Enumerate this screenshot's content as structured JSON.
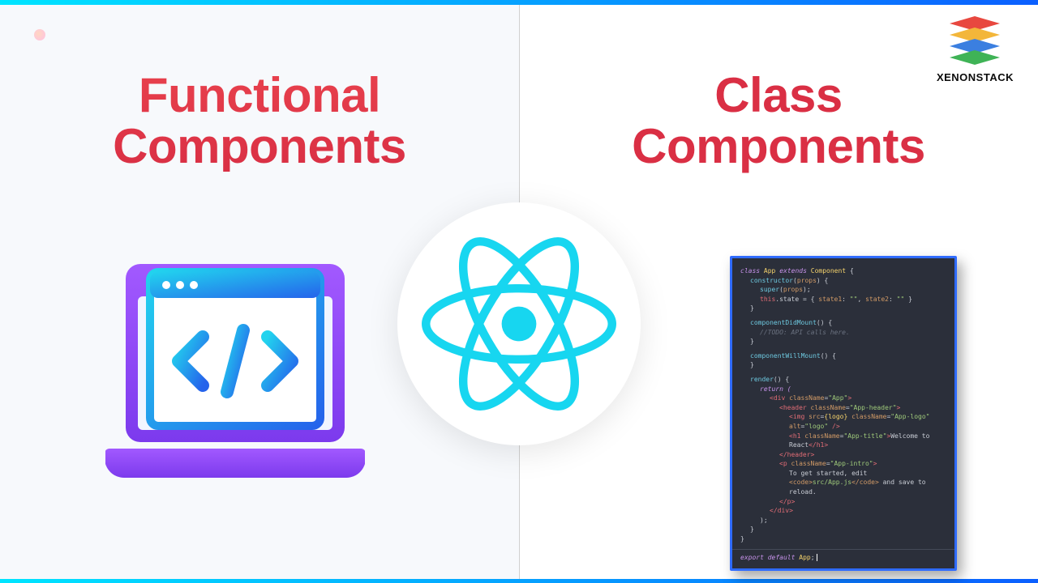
{
  "brand": {
    "name": "XENONSTACK"
  },
  "left": {
    "title_line1": "Functional",
    "title_line2": "Components"
  },
  "right": {
    "title_line1": "Class",
    "title_line2": "Components"
  },
  "colors": {
    "accent_red": "#da2f44",
    "react_cyan": "#17d6f0",
    "frame_blue": "#2f6bff"
  },
  "code": {
    "l1_kw1": "class",
    "l1_cls": "App",
    "l1_kw2": "extends",
    "l1_sup": "Component",
    "l1_brace": "{",
    "l2_fn": "constructor",
    "l2_arg": "props",
    "l2_brace": "{",
    "l3_super": "super",
    "l3_arg": "props",
    "l3_end": ";",
    "l4_this": "this",
    "l4_state": ".state = { ",
    "l4_k1": "state1",
    "l4_v1": "\"\"",
    "l4_k2": "state2",
    "l4_v2": "\"\"",
    "l4_end": " }",
    "l5_close": "}",
    "l6_fn": "componentDidMount",
    "l6_rest": "() {",
    "l7_comment": "//TODO: API calls here.",
    "l8_close": "}",
    "l9_fn": "componentWillMount",
    "l9_rest": "() {",
    "l10_close": "}",
    "l11_fn": "render",
    "l11_rest": "() {",
    "l12_ret": "return (",
    "l13_open": "<div ",
    "l13_attr": "className",
    "l13_val": "\"App\"",
    "l13_end": ">",
    "l14_open": "<header ",
    "l14_attr": "className",
    "l14_val": "\"App-header\"",
    "l14_end": ">",
    "l15_open": "<img ",
    "l15_a1": "src",
    "l15_v1": "{logo}",
    "l15_a2": "className",
    "l15_v2": "\"App-logo\"",
    "l15_a3": "alt",
    "l15_v3": "\"logo\"",
    "l15_end": " />",
    "l16_open": "<h1 ",
    "l16_attr": "className",
    "l16_val": "\"App-title\"",
    "l16_txt": "Welcome to React",
    "l16_close": "</h1>",
    "l17_close": "</header>",
    "l18_open": "<p ",
    "l18_attr": "className",
    "l18_val": "\"App-intro\"",
    "l18_end": ">",
    "l19_a": "To get started, edit ",
    "l19_code": "src/App.js",
    "l19_b": " and save to",
    "l20_txt": "reload.",
    "l21_close": "</p>",
    "l22_close": "</div>",
    "l23_close": ");",
    "l24_close": "}",
    "l25_close": "}",
    "l26_kw": "export default",
    "l26_cls": "App",
    "l26_end": ";"
  }
}
